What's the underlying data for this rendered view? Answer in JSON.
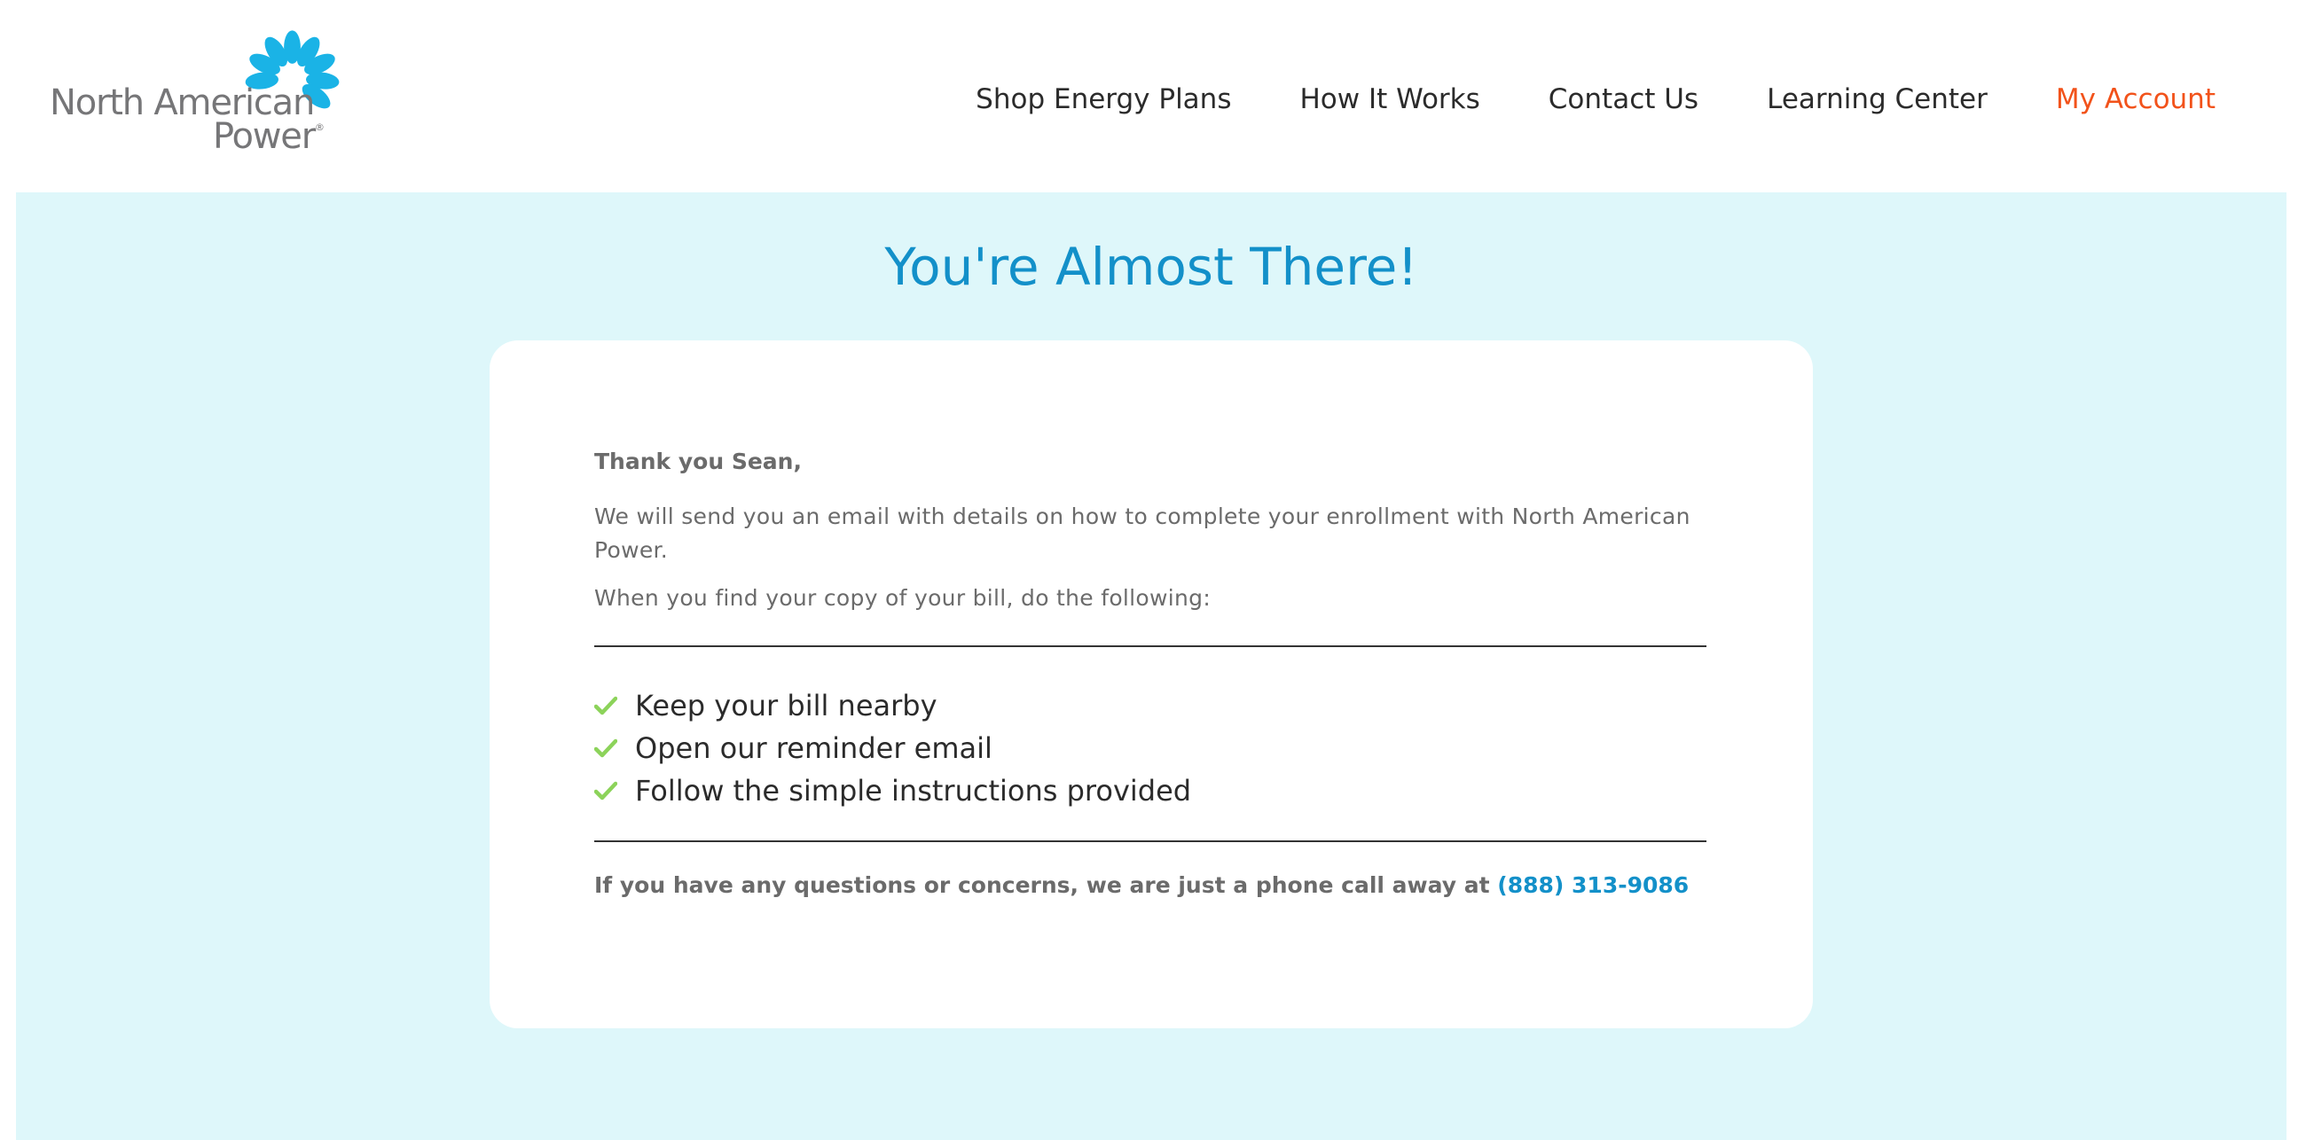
{
  "brand": {
    "logo_line1": "North American",
    "logo_line2": "Power",
    "logo_mark": "®",
    "logo_color": "#1ab3e6",
    "text_color": "#767678"
  },
  "nav": {
    "items": [
      {
        "label": "Shop Energy Plans"
      },
      {
        "label": "How It Works"
      },
      {
        "label": "Contact Us"
      },
      {
        "label": "Learning Center"
      },
      {
        "label": "My Account"
      }
    ],
    "accent_color": "#f2521a"
  },
  "hero": {
    "title": "You're Almost There!",
    "background": "#def7fa",
    "title_color": "#1390c9"
  },
  "card": {
    "greeting": "Thank you Sean,",
    "paragraph1": "We will send you an email with details on how to complete your enrollment with North American Power.",
    "paragraph2": "When you find your copy of your bill, do the following:",
    "checklist": [
      "Keep your bill nearby",
      "Open our reminder email",
      "Follow the simple instructions provided"
    ],
    "check_icon": "check-icon",
    "check_color": "#8cd35a",
    "contact_text": "If you have any questions or concerns, we are just a phone call away at",
    "phone": "(888) 313-9086"
  }
}
